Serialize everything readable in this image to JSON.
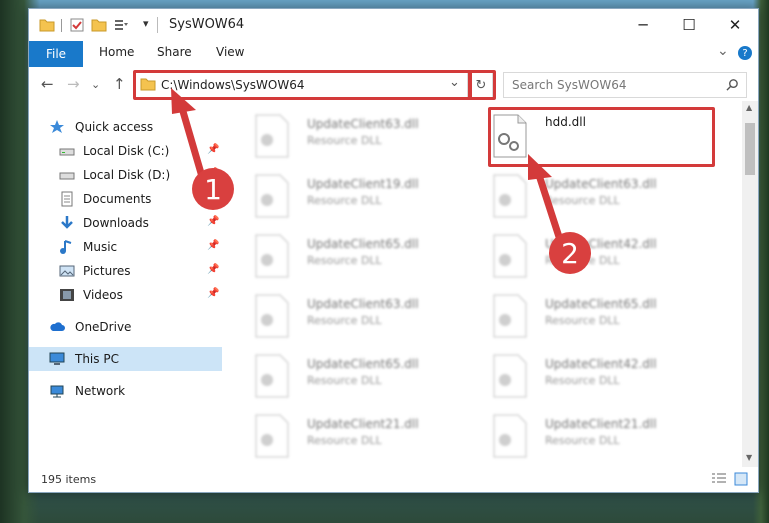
{
  "window": {
    "title": "SysWOW64",
    "minimize_glyph": "─",
    "maximize_glyph": "☐",
    "close_glyph": "✕"
  },
  "ribbon": {
    "file": "File",
    "home": "Home",
    "share": "Share",
    "view": "View",
    "expand_glyph": "⌄",
    "help_glyph": "?"
  },
  "address": {
    "path": "C:\\Windows\\SysWOW64",
    "dropdown_glyph": "⌄",
    "refresh_glyph": "↻",
    "back_glyph": "←",
    "forward_glyph": "→",
    "recent_glyph": "⌄",
    "up_glyph": "↑"
  },
  "search": {
    "placeholder": "Search SysWOW64",
    "icon": "search-icon"
  },
  "nav": {
    "items": [
      {
        "label": "Quick access",
        "icon": "star-icon"
      },
      {
        "label": "Local Disk (C:)",
        "icon": "drive-icon",
        "pinned": true
      },
      {
        "label": "Local Disk (D:)",
        "icon": "drive-icon",
        "pinned": true
      },
      {
        "label": "Documents",
        "icon": "documents-icon",
        "pinned": true
      },
      {
        "label": "Downloads",
        "icon": "download-icon",
        "pinned": true
      },
      {
        "label": "Music",
        "icon": "music-icon",
        "pinned": true
      },
      {
        "label": "Pictures",
        "icon": "pictures-icon",
        "pinned": true
      },
      {
        "label": "Videos",
        "icon": "videos-icon",
        "pinned": true
      },
      {
        "label": "OneDrive",
        "icon": "cloud-icon"
      },
      {
        "label": "This PC",
        "icon": "computer-icon"
      },
      {
        "label": "Network",
        "icon": "network-icon"
      }
    ]
  },
  "files": {
    "left": [
      {
        "name": "UpdateClient63.dll",
        "type": "Resource DLL"
      },
      {
        "name": "UpdateClient19.dll",
        "type": "Resource DLL"
      },
      {
        "name": "UpdateClient65.dll",
        "type": "Resource DLL"
      },
      {
        "name": "UpdateClient63.dll",
        "type": "Resource DLL"
      },
      {
        "name": "UpdateClient65.dll",
        "type": "Resource DLL"
      },
      {
        "name": "UpdateClient21.dll",
        "type": "Resource DLL"
      }
    ],
    "right": [
      {
        "name": "hdd.dll",
        "type": ""
      },
      {
        "name": "UpdateClient63.dll",
        "type": "Resource DLL"
      },
      {
        "name": "UpdateClient42.dll",
        "type": "Resource DLL"
      },
      {
        "name": "UpdateClient65.dll",
        "type": "Resource DLL"
      },
      {
        "name": "UpdateClient42.dll",
        "type": "Resource DLL"
      },
      {
        "name": "UpdateClient21.dll",
        "type": "Resource DLL"
      }
    ]
  },
  "status": {
    "item_count": "195 items"
  },
  "annotations": {
    "step1": "1",
    "step2": "2",
    "color": "#d33a3a"
  }
}
